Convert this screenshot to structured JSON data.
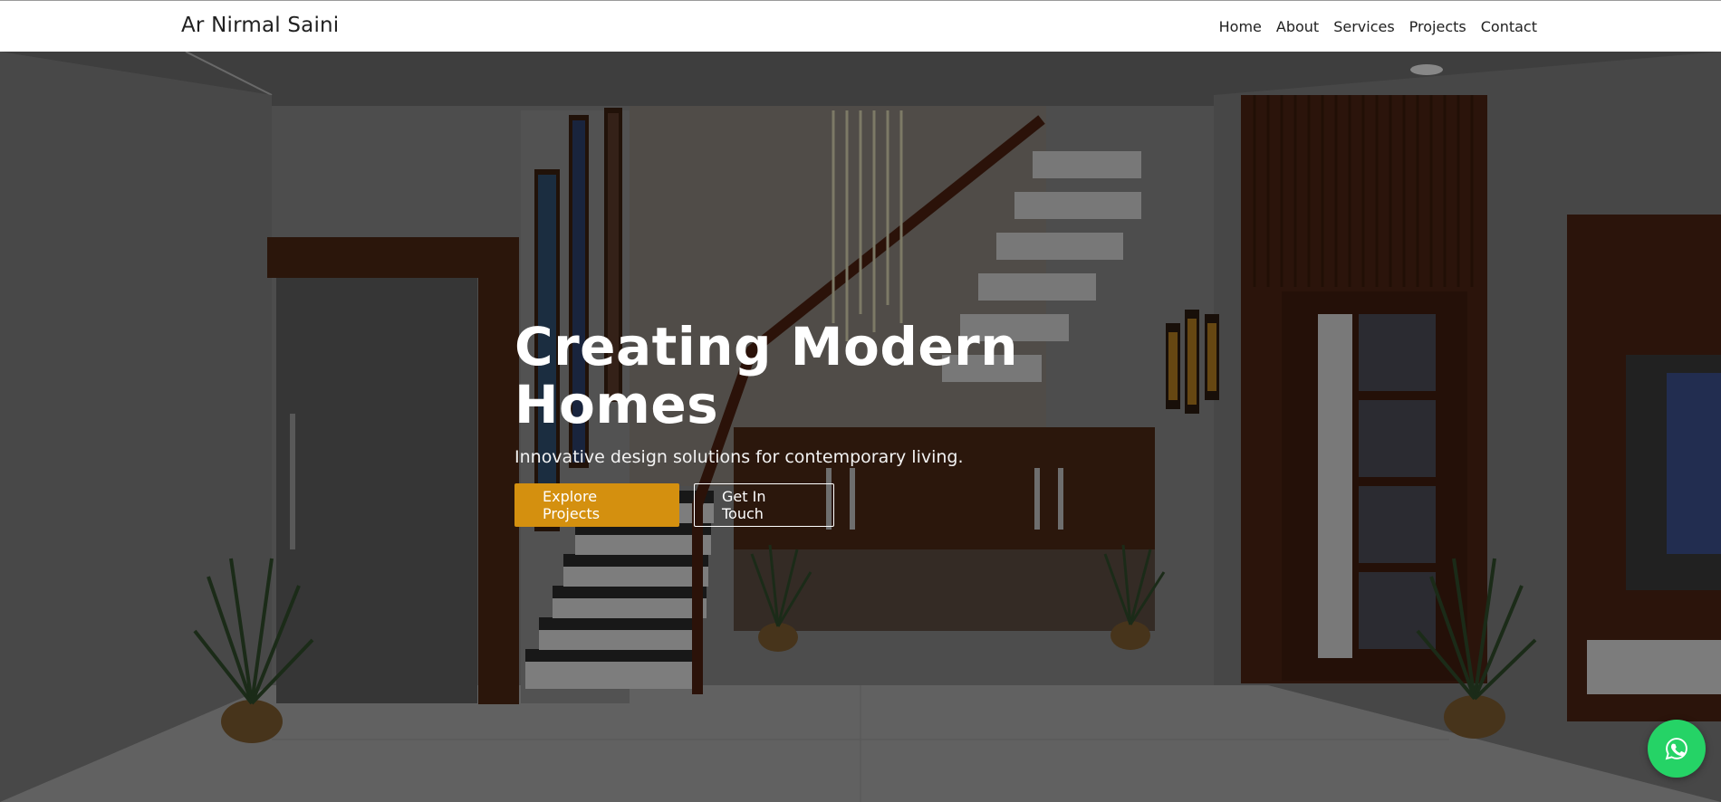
{
  "brand": {
    "name": "Ar Nirmal Saini"
  },
  "nav": {
    "items": [
      {
        "label": "Home"
      },
      {
        "label": "About"
      },
      {
        "label": "Services"
      },
      {
        "label": "Projects"
      },
      {
        "label": "Contact"
      }
    ]
  },
  "hero": {
    "title": "Creating Modern Homes",
    "subtitle": "Innovative design solutions for contemporary living.",
    "primary_button": "Explore Projects",
    "secondary_button": "Get In Touch",
    "background_image": "modern interior with staircase, wooden panels and potted plants"
  },
  "whatsapp": {
    "icon": "whatsapp-icon"
  },
  "colors": {
    "accent": "#d4900f",
    "whatsapp": "#25d366",
    "navbar_bg": "#ffffff",
    "text_dark": "#212121"
  }
}
